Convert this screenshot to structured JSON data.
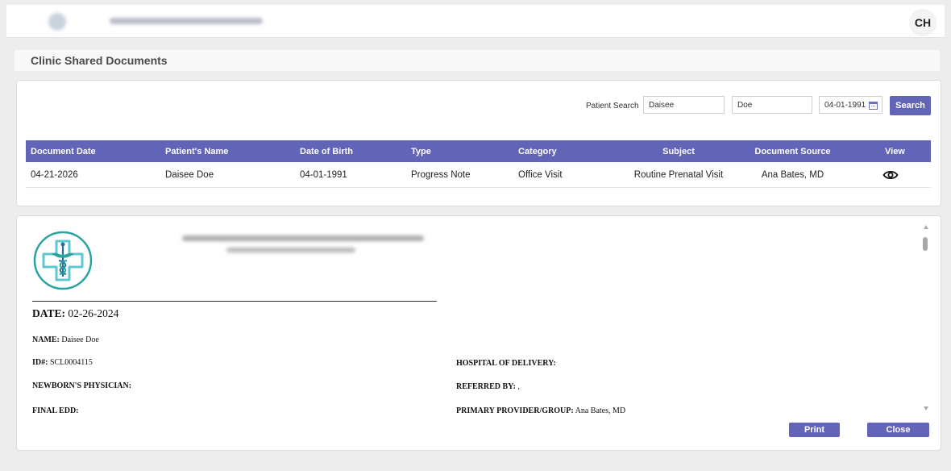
{
  "header": {
    "user_initials": "CH"
  },
  "page": {
    "title": "Clinic Shared Documents"
  },
  "search": {
    "label": "Patient Search",
    "first_name": "Daisee",
    "last_name": "Doe",
    "dob": "04-01-1991",
    "button_label": "Search"
  },
  "table": {
    "columns": [
      "Document Date",
      "Patient's Name",
      "Date of Birth",
      "Type",
      "Category",
      "Subject",
      "Document Source",
      "View"
    ],
    "rows": [
      {
        "document_date": "04-21-2026",
        "patient_name": "Daisee Doe",
        "dob": "04-01-1991",
        "type": "Progress Note",
        "category": "Office Visit",
        "subject": "Routine Prenatal Visit",
        "source": "Ana Bates, MD",
        "view_icon": "eye-icon"
      }
    ]
  },
  "document": {
    "date_label": "DATE:",
    "date_value": "02-26-2024",
    "name_label": "NAME:",
    "name_value": "Daisee Doe",
    "id_label": "ID#:",
    "id_value": "SCL0004115",
    "newborn_physician_label": "NEWBORN'S PHYSICIAN:",
    "final_edd_label": "FINAL EDD:",
    "hospital_label": "HOSPITAL OF DELIVERY:",
    "referred_label": "REFERRED BY:",
    "referred_value": ",",
    "primary_provider_label": "PRIMARY PROVIDER/GROUP:",
    "primary_provider_value": "Ana Bates, MD"
  },
  "viewer": {
    "print_label": "Print",
    "close_label": "Close"
  },
  "colors": {
    "accent": "#6264b8",
    "logo_ring": "#2aa3a0",
    "logo_cross": "#5ec7d3"
  }
}
